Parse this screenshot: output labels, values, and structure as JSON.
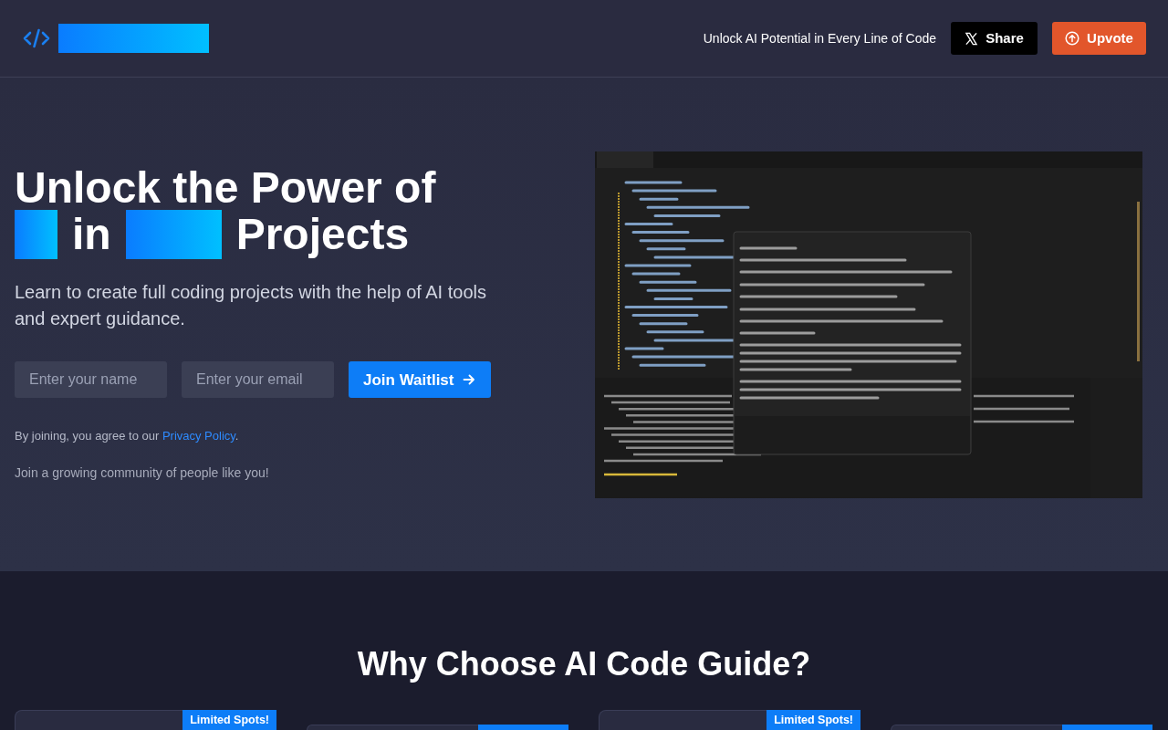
{
  "header": {
    "tagline": "Unlock AI Potential in Every Line of Code",
    "share": "Share",
    "upvote": "Upvote"
  },
  "hero": {
    "title_line_1": "Unlock the Power of",
    "title_line_2": [
      {
        "kind": "block"
      },
      {
        "kind": "text",
        "text": "in"
      },
      {
        "kind": "block"
      },
      {
        "kind": "text",
        "text": "Projects"
      }
    ],
    "subtitle": "Learn to create full coding projects with the help of AI tools and expert guidance.",
    "name_field": {
      "placeholder": "Enter your name"
    },
    "email_field": {
      "placeholder": "Enter your email"
    },
    "submit": "Join Waitlist",
    "consent": "By joining, you agree to our",
    "consent_link": "Privacy Policy",
    "consent_end": ".",
    "community": "Join a growing community of people like you!"
  },
  "features": {
    "title": "Why Choose AI Code Guide?",
    "cards": [
      {
        "badge": true,
        "badge_text": "Limited Spots!"
      },
      {
        "badge": true
      },
      {
        "badge": true,
        "badge_text": "Limited Spots!"
      },
      {
        "badge": true
      }
    ]
  }
}
